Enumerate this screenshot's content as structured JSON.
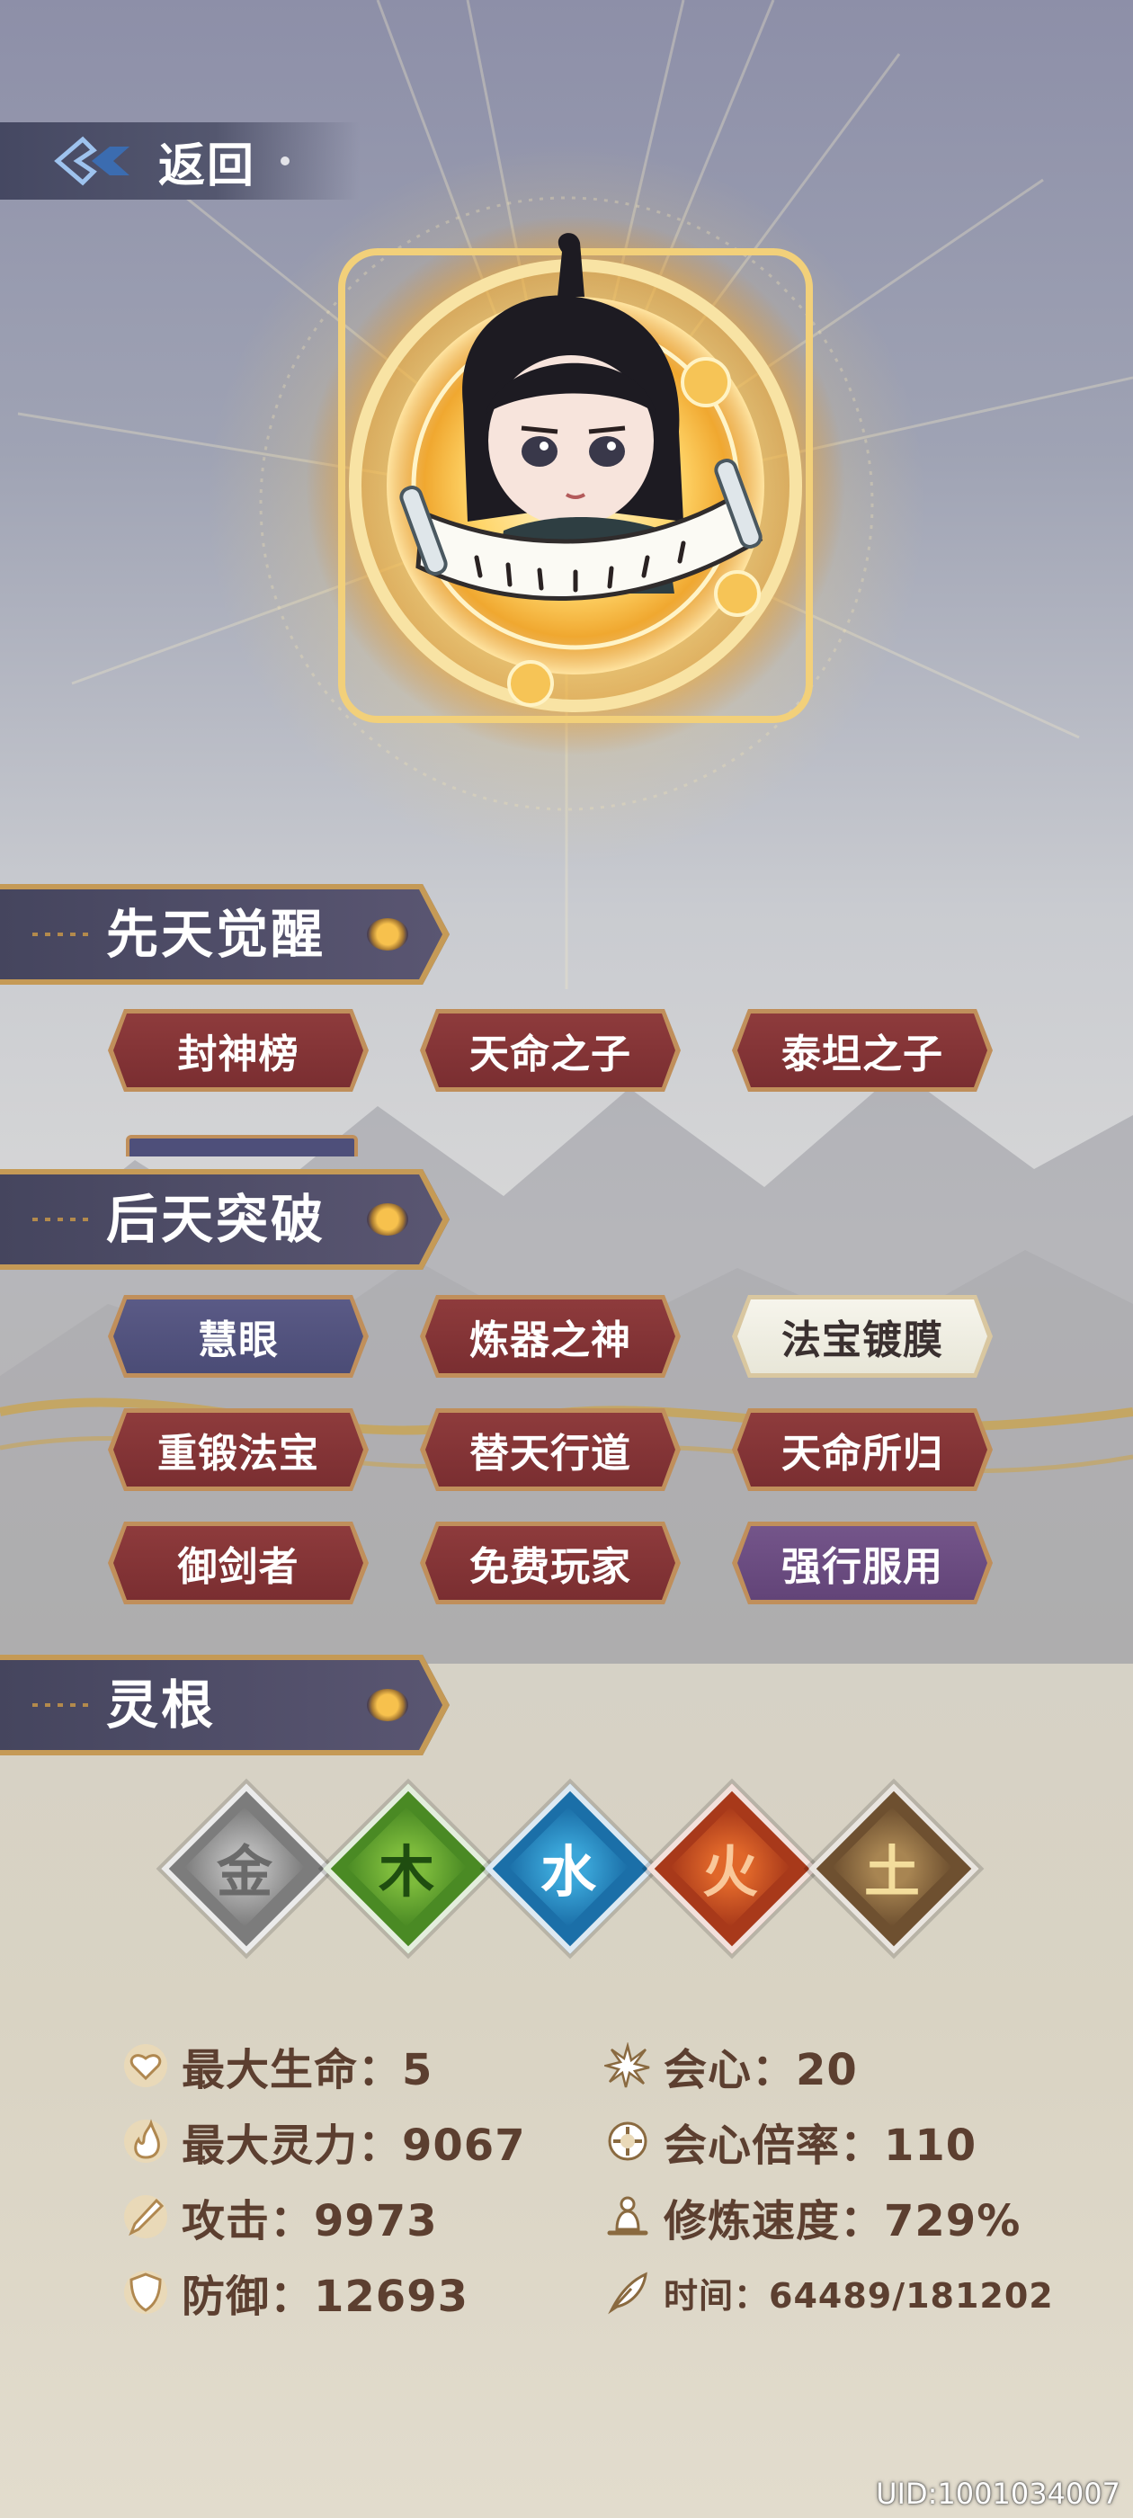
{
  "nav": {
    "back_label": "返回"
  },
  "sections": {
    "innate": {
      "title": "先天觉醒",
      "tags": [
        {
          "label": "封神榜",
          "style": "red"
        },
        {
          "label": "天命之子",
          "style": "red"
        },
        {
          "label": "泰坦之子",
          "style": "red"
        }
      ]
    },
    "acquired": {
      "title": "后天突破",
      "tags": [
        {
          "label": "慧眼",
          "style": "blue"
        },
        {
          "label": "炼器之神",
          "style": "red"
        },
        {
          "label": "法宝镀膜",
          "style": "white"
        },
        {
          "label": "重锻法宝",
          "style": "red"
        },
        {
          "label": "替天行道",
          "style": "red"
        },
        {
          "label": "天命所归",
          "style": "red"
        },
        {
          "label": "御剑者",
          "style": "red"
        },
        {
          "label": "免费玩家",
          "style": "red"
        },
        {
          "label": "强行服用",
          "style": "purple"
        }
      ]
    },
    "roots": {
      "title": "灵根",
      "elements": [
        {
          "char": "金",
          "color": "#b8b8b8",
          "dark": "#7c7c7c",
          "text": "#6a6a6a"
        },
        {
          "char": "木",
          "color": "#7dbb3c",
          "dark": "#4a8a24",
          "text": "#1f4d10"
        },
        {
          "char": "水",
          "color": "#3aa5d8",
          "dark": "#1b6fa8",
          "text": "#ffffff"
        },
        {
          "char": "火",
          "color": "#e0672a",
          "dark": "#a8391a",
          "text": "#f9c89a"
        },
        {
          "char": "土",
          "color": "#a88552",
          "dark": "#6e5030",
          "text": "#f3dd9c"
        }
      ]
    }
  },
  "stats": {
    "max_hp": "最大生命：5",
    "crit": "会心：20",
    "max_mana": "最大灵力：9067",
    "crit_rate": "会心倍率：110",
    "attack": "攻击：9973",
    "cultivation": "修炼速度：729%",
    "defense": "防御：12693",
    "time": "时间：64489/181202"
  },
  "uid": "UID:1001034007"
}
